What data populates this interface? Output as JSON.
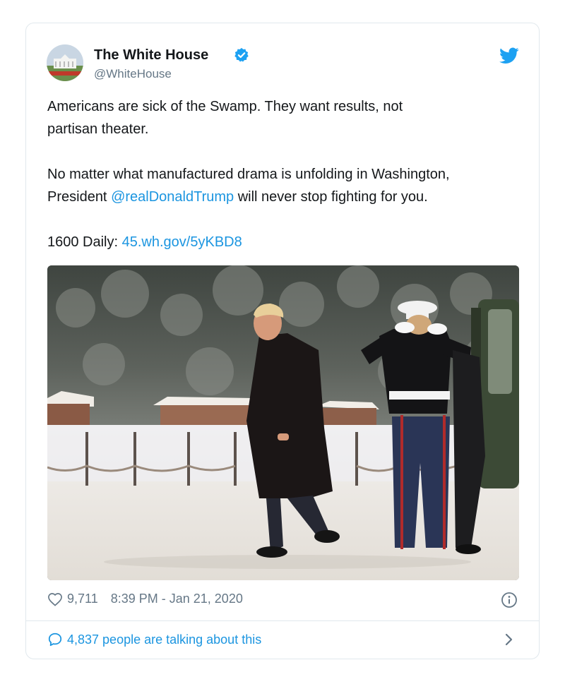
{
  "tweet": {
    "author_name": "The White House",
    "author_handle": "@WhiteHouse",
    "line1": "Americans are sick of the Swamp. They want results, not",
    "line2": "partisan theater.",
    "line3": "No matter what manufactured drama is unfolding in Washington,",
    "line4_prefix": "President ",
    "line4_mention": "@realDonaldTrump",
    "line4_suffix": " will never stop fighting for you.",
    "line5_prefix": "1600 Daily: ",
    "line5_link": "45.wh.gov/5yKBD8",
    "likes": "9,711",
    "timestamp": "8:39 PM - Jan 21, 2020",
    "talking": "4,837 people are talking about this"
  },
  "colors": {
    "link": "#1b95e0",
    "verified": "#1da1f2",
    "secondary_text": "#657786",
    "border": "#e1e8ed"
  },
  "icons": [
    "verified-badge-icon",
    "twitter-bird-icon",
    "heart-icon",
    "info-icon",
    "comment-bubble-icon",
    "chevron-right-icon"
  ]
}
